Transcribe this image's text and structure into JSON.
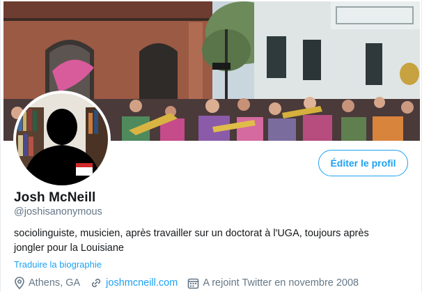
{
  "profile": {
    "display_name": "Josh McNeill",
    "handle": "@joshisanonymous",
    "bio_line1": "sociolinguiste, musicien, après travailler sur un doctorat à l'UGA, toujours après",
    "bio_line2": "jongler pour la Louisiane",
    "translate_label": "Traduire la biographie",
    "location": "Athens, GA",
    "website": "joshmcneill.com",
    "joined": "A rejoint Twitter en novembre 2008",
    "avatar_name_tag": "Josh",
    "avatar_tag_header": "HELLO"
  },
  "actions": {
    "edit_profile_label": "Éditer le profil"
  },
  "icons": {
    "location": "location-pin-icon",
    "website": "link-icon",
    "joined": "calendar-icon"
  },
  "colors": {
    "accent": "#1da1f2",
    "secondary_text": "#657786",
    "primary_text": "#14171a"
  }
}
